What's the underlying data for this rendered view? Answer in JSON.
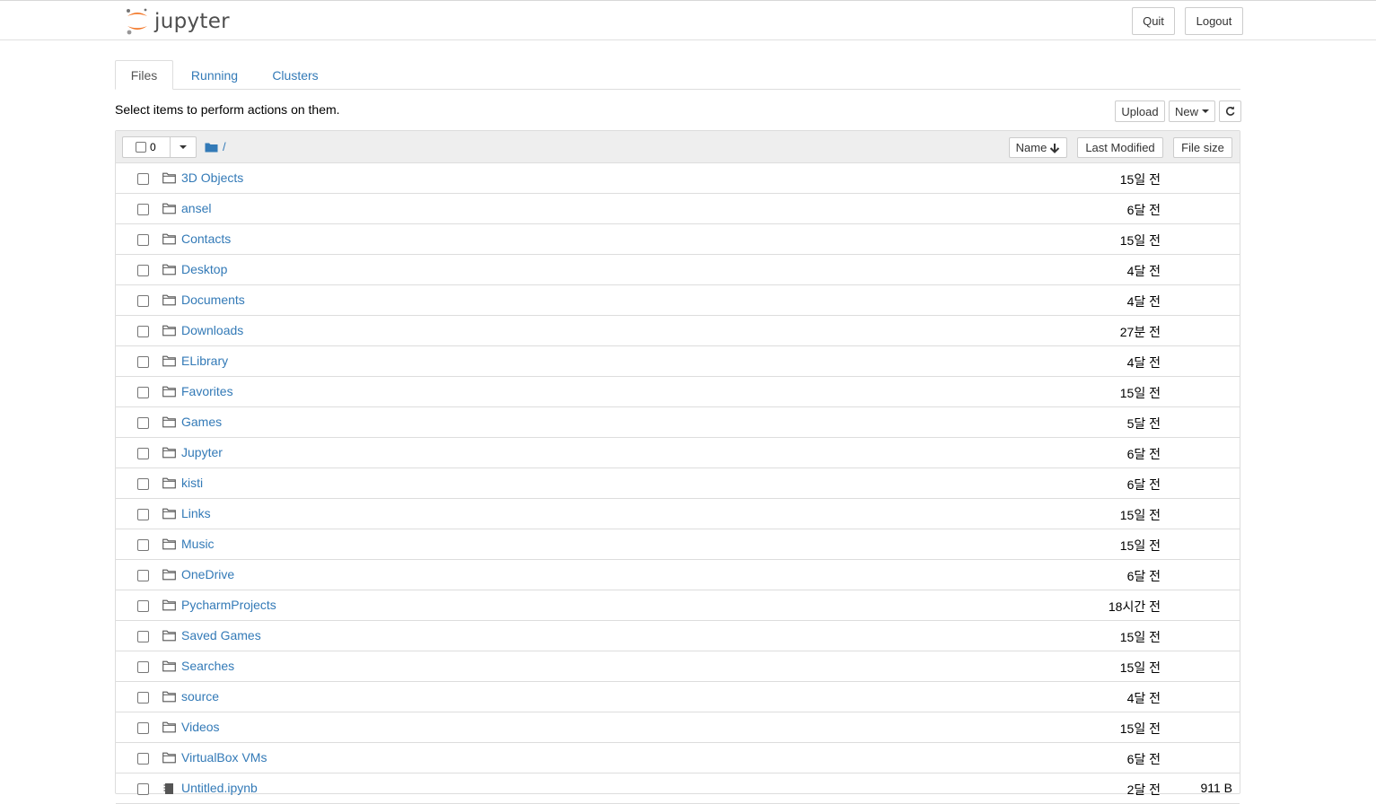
{
  "header": {
    "logo_text": "jupyter",
    "quit_label": "Quit",
    "logout_label": "Logout"
  },
  "tabs": [
    {
      "label": "Files",
      "active": true
    },
    {
      "label": "Running",
      "active": false
    },
    {
      "label": "Clusters",
      "active": false
    }
  ],
  "toolbar": {
    "hint": "Select items to perform actions on them.",
    "upload_label": "Upload",
    "new_label": "New",
    "refresh_icon": "refresh-icon"
  },
  "list_header": {
    "selected_count": "0",
    "breadcrumb_path": "/",
    "sort_name_label": "Name",
    "sort_modified_label": "Last Modified",
    "sort_size_label": "File size"
  },
  "colors": {
    "link": "#337ab7",
    "logo_orange": "#F37626",
    "header_gray": "#eeeeee"
  },
  "files": [
    {
      "name": "3D Objects",
      "type": "folder",
      "modified": "15일 전",
      "size": ""
    },
    {
      "name": "ansel",
      "type": "folder",
      "modified": "6달 전",
      "size": ""
    },
    {
      "name": "Contacts",
      "type": "folder",
      "modified": "15일 전",
      "size": ""
    },
    {
      "name": "Desktop",
      "type": "folder",
      "modified": "4달 전",
      "size": ""
    },
    {
      "name": "Documents",
      "type": "folder",
      "modified": "4달 전",
      "size": ""
    },
    {
      "name": "Downloads",
      "type": "folder",
      "modified": "27분 전",
      "size": ""
    },
    {
      "name": "ELibrary",
      "type": "folder",
      "modified": "4달 전",
      "size": ""
    },
    {
      "name": "Favorites",
      "type": "folder",
      "modified": "15일 전",
      "size": ""
    },
    {
      "name": "Games",
      "type": "folder",
      "modified": "5달 전",
      "size": ""
    },
    {
      "name": "Jupyter",
      "type": "folder",
      "modified": "6달 전",
      "size": ""
    },
    {
      "name": "kisti",
      "type": "folder",
      "modified": "6달 전",
      "size": ""
    },
    {
      "name": "Links",
      "type": "folder",
      "modified": "15일 전",
      "size": ""
    },
    {
      "name": "Music",
      "type": "folder",
      "modified": "15일 전",
      "size": ""
    },
    {
      "name": "OneDrive",
      "type": "folder",
      "modified": "6달 전",
      "size": ""
    },
    {
      "name": "PycharmProjects",
      "type": "folder",
      "modified": "18시간 전",
      "size": ""
    },
    {
      "name": "Saved Games",
      "type": "folder",
      "modified": "15일 전",
      "size": ""
    },
    {
      "name": "Searches",
      "type": "folder",
      "modified": "15일 전",
      "size": ""
    },
    {
      "name": "source",
      "type": "folder",
      "modified": "4달 전",
      "size": ""
    },
    {
      "name": "Videos",
      "type": "folder",
      "modified": "15일 전",
      "size": ""
    },
    {
      "name": "VirtualBox VMs",
      "type": "folder",
      "modified": "6달 전",
      "size": ""
    },
    {
      "name": "Untitled.ipynb",
      "type": "notebook",
      "modified": "2달 전",
      "size": "911 B"
    }
  ]
}
